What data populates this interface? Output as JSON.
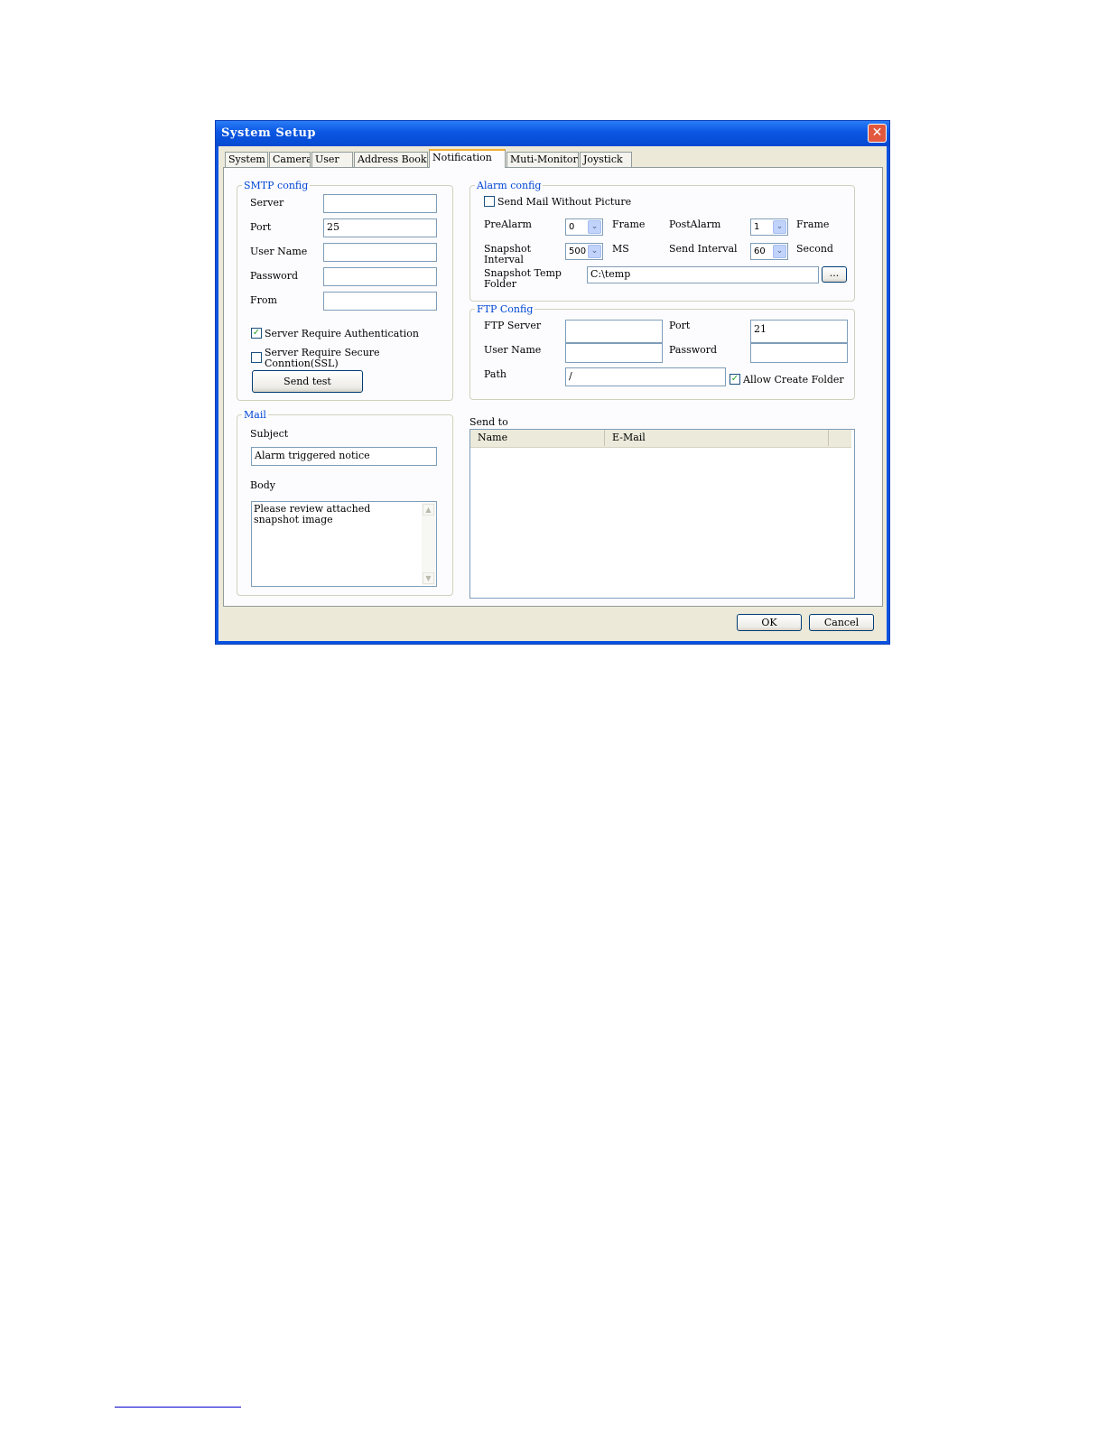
{
  "window": {
    "title": "System Setup",
    "close_glyph": "✕"
  },
  "tabs": [
    {
      "label": "System"
    },
    {
      "label": "Camera"
    },
    {
      "label": "User"
    },
    {
      "label": "Address Book"
    },
    {
      "label": "Notification",
      "active": true
    },
    {
      "label": "Muti-Monitor"
    },
    {
      "label": "Joystick"
    }
  ],
  "smtp": {
    "legend": "SMTP config",
    "server_label": "Server",
    "server_value": "",
    "port_label": "Port",
    "port_value": "25",
    "username_label": "User Name",
    "username_value": "",
    "password_label": "Password",
    "password_value": "",
    "from_label": "From",
    "from_value": "",
    "require_auth_label": "Server Require Authentication",
    "require_auth_checked": true,
    "require_ssl_label_line1": "Server Require Secure",
    "require_ssl_label_line2": "Conntion(SSL)",
    "require_ssl_checked": false,
    "send_test_label": "Send test"
  },
  "alarm": {
    "legend": "Alarm config",
    "no_picture_label": "Send Mail Without Picture",
    "no_picture_checked": false,
    "prealarm_label": "PreAlarm",
    "prealarm_value": "0",
    "prealarm_unit": "Frame",
    "postalarm_label": "PostAlarm",
    "postalarm_value": "1",
    "postalarm_unit": "Frame",
    "snapshot_interval_label_line1": "Snapshot",
    "snapshot_interval_label_line2": "Interval",
    "snapshot_interval_value": "500",
    "snapshot_interval_unit": "MS",
    "send_interval_label": "Send Interval",
    "send_interval_value": "60",
    "send_interval_unit": "Second",
    "temp_folder_label_line1": "Snapshot Temp",
    "temp_folder_label_line2": "Folder",
    "temp_folder_value": "C:\\temp",
    "browse_label": "..."
  },
  "ftp": {
    "legend": "FTP Config",
    "server_label": "FTP Server",
    "server_value": "",
    "port_label": "Port",
    "port_value": "21",
    "username_label": "User Name",
    "username_value": "",
    "password_label": "Password",
    "password_value": "",
    "path_label": "Path",
    "path_value": "/",
    "allow_create_label": "Allow Create Folder",
    "allow_create_checked": true
  },
  "mail": {
    "legend": "Mail",
    "subject_label": "Subject",
    "subject_value": "Alarm triggered notice",
    "body_label": "Body",
    "body_line1": "Please review attached",
    "body_line2": "snapshot image"
  },
  "send_to": {
    "label": "Send to",
    "columns": [
      "Name",
      "E-Mail"
    ]
  },
  "footer": {
    "ok_label": "OK",
    "cancel_label": "Cancel"
  },
  "icons": {
    "check": "✓",
    "dropdown": "⌄",
    "scroll_up": "▲",
    "scroll_down": "▼"
  }
}
